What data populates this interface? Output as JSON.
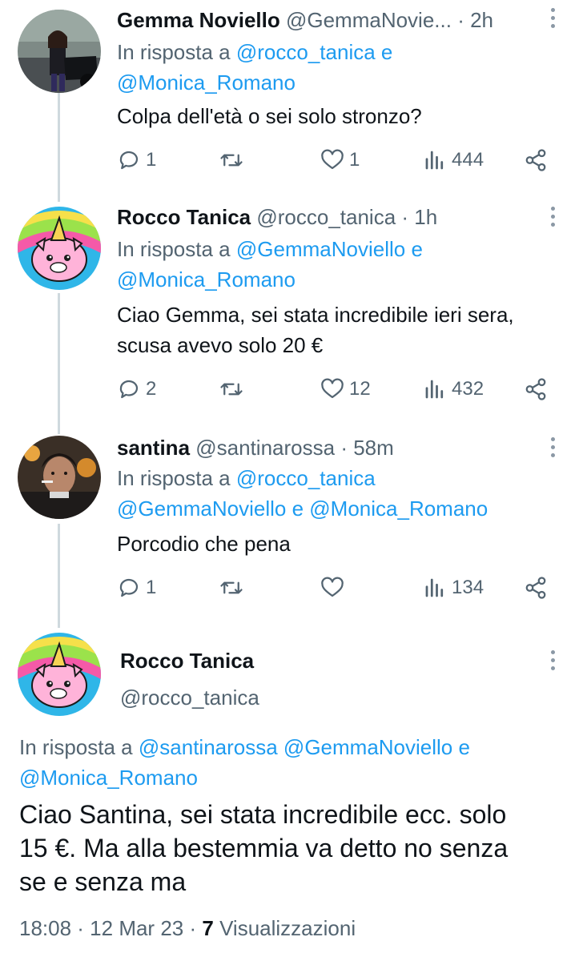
{
  "tweets": [
    {
      "name": "Gemma Noviello",
      "handle": "@GemmaNovie...",
      "time": "· 2h",
      "reply_prefix": "In risposta a",
      "reply_mention_1": "@rocco_tanica",
      "reply_conj": "e",
      "reply_mention_2": "@Monica_Romano",
      "text": "Colpa dell'età o sei solo stronzo?",
      "replies": "1",
      "retweets": "",
      "likes": "1",
      "views": "444"
    },
    {
      "name": "Rocco Tanica",
      "handle": "@rocco_tanica",
      "time": "· 1h",
      "reply_prefix": "In risposta a",
      "reply_mention_1": "@GemmaNoviello",
      "reply_conj": "e",
      "reply_mention_2": "@Monica_Romano",
      "text_line_1": "Ciao Gemma, sei stata incredibile ieri sera,",
      "text_line_2": "scusa avevo solo 20 €",
      "replies": "2",
      "retweets": "",
      "likes": "12",
      "views": "432"
    },
    {
      "name": "santina",
      "handle": "@santinarossa",
      "time": "· 58m",
      "reply_prefix": "In risposta a",
      "reply_mention_1": "@rocco_tanica",
      "reply_mention_2": "@GemmaNoviello",
      "reply_conj": "e",
      "reply_mention_3": "@Monica_Romano",
      "text": "Porcodio che pena",
      "replies": "1",
      "retweets": "",
      "likes": "",
      "views": "134"
    }
  ],
  "main_tweet": {
    "name": "Rocco Tanica",
    "handle": "@rocco_tanica",
    "reply_prefix": "In risposta a",
    "reply_mention_1": "@santinarossa",
    "reply_mention_2": "@GemmaNoviello",
    "reply_conj": "e",
    "reply_mention_3": "@Monica_Romano",
    "text_line_1": "Ciao Santina, sei stata incredibile ecc. solo",
    "text_line_2": "15 €. Ma alla bestemmia va detto no senza",
    "text_line_3": "se e senza ma",
    "time": "18:08 · 12 Mar 23 ·",
    "views_count": "7",
    "views_label": "Visualizzazioni"
  },
  "colors": {
    "accent": "#1d9bf0",
    "secondary_text": "#536471",
    "thread_line": "#cfd9de"
  },
  "icons": [
    "reply-icon",
    "retweet-icon",
    "like-icon",
    "views-icon",
    "share-icon",
    "more-icon"
  ]
}
